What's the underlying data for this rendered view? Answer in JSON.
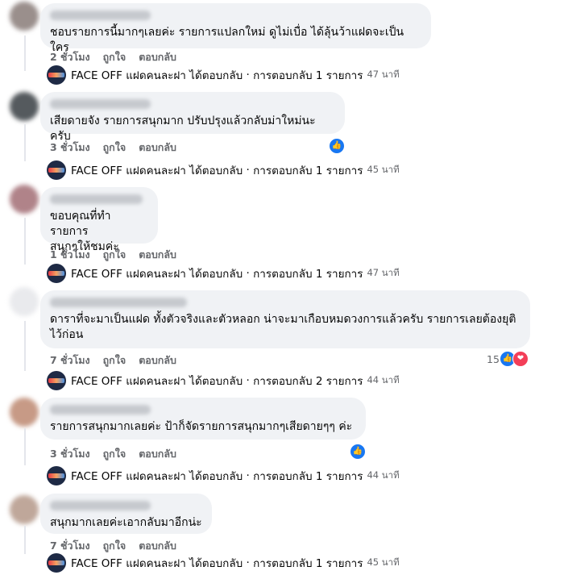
{
  "comments": [
    {
      "text": "ชอบรายการนี้มากๆเลยค่ะ รายการแปลกใหม่ ดูไม่เบื่อ ได้ลุ้นว้าแฝดจะเป็นใคร",
      "time": "2 ชั่วโมง",
      "like": "ถูกใจ",
      "reply": "ตอบกลับ",
      "page_reply": {
        "name": "FACE OFF แฝดคนละฝา",
        "action": "ได้ตอบกลับ",
        "sep": "·",
        "replies": "การตอบกลับ 1 รายการ",
        "time": "47 นาที"
      }
    },
    {
      "text": "เสียดายจัง รายการสนุกมาก ปรับปรุงแล้วกลับม่าใหม่นะครับ",
      "time": "3 ชั่วโมง",
      "like": "ถูกใจ",
      "reply": "ตอบกลับ",
      "reaction_icon": "like-icon",
      "page_reply": {
        "name": "FACE OFF แฝดคนละฝา",
        "action": "ได้ตอบกลับ",
        "sep": "·",
        "replies": "การตอบกลับ 1 รายการ",
        "time": "45 นาที"
      }
    },
    {
      "text_line1": "ขอบคุณที่ทำรายการ",
      "text_line2": "สนุกๆให้ชมค่ะ",
      "time": "1 ชั่วโมง",
      "like": "ถูกใจ",
      "reply": "ตอบกลับ",
      "page_reply": {
        "name": "FACE OFF แฝดคนละฝา",
        "action": "ได้ตอบกลับ",
        "sep": "·",
        "replies": "การตอบกลับ 1 รายการ",
        "time": "47 นาที"
      }
    },
    {
      "text_line1": "ดาราที่จะมาเป็นแฝด ทั้งตัวจริงและตัวหลอก น่าจะมาเกือบหมดวงการแล้วครับ รายการเลยต้องยุติ",
      "text_line2": "ไว้ก่อน",
      "time": "7 ชั่วโมง",
      "like": "ถูกใจ",
      "reply": "ตอบกลับ",
      "reaction_count": "15",
      "reaction_icons": [
        "like-icon",
        "love-icon"
      ],
      "page_reply": {
        "name": "FACE OFF แฝดคนละฝา",
        "action": "ได้ตอบกลับ",
        "sep": "·",
        "replies": "การตอบกลับ 2 รายการ",
        "time": "44 นาที"
      }
    },
    {
      "text": "รายการสนุกมากเลยค่ะ ป้าก็จัดรายการสนุกมากๆเสียดายๆๆ ค่ะ",
      "time": "3 ชั่วโมง",
      "like": "ถูกใจ",
      "reply": "ตอบกลับ",
      "reaction_icon": "like-icon",
      "page_reply": {
        "name": "FACE OFF แฝดคนละฝา",
        "action": "ได้ตอบกลับ",
        "sep": "·",
        "replies": "การตอบกลับ 1 รายการ",
        "time": "44 นาที"
      }
    },
    {
      "text": "สนุกมากเลยค่ะเอากลับมาอีกน่ะ",
      "time": "7 ชั่วโมง",
      "like": "ถูกใจ",
      "reply": "ตอบกลับ",
      "page_reply": {
        "name": "FACE OFF แฝดคนละฝา",
        "action": "ได้ตอบกลับ",
        "sep": "·",
        "replies": "การตอบกลับ 1 รายการ",
        "time": "45 นาที"
      }
    }
  ],
  "colors": {
    "bubble": "#f0f2f5",
    "like_blue": "#1877f2",
    "love_red": "#f33e58",
    "meta_gray": "#65676b"
  }
}
